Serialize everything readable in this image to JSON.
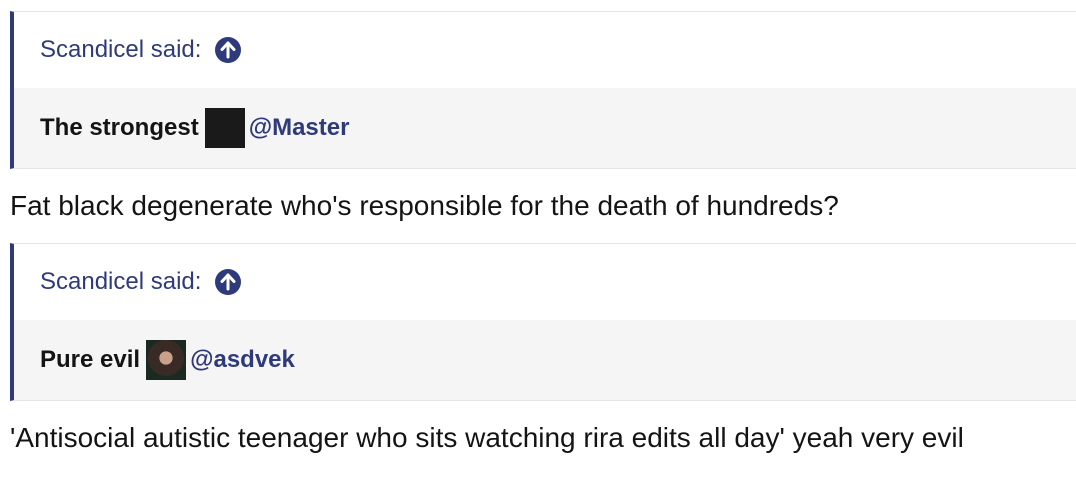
{
  "posts": [
    {
      "quote_author": "Scandicel said:",
      "quote_text": "The strongest",
      "mention": "@Master",
      "reply": "Fat black degenerate who's responsible for the death of hundreds?"
    },
    {
      "quote_author": "Scandicel said:",
      "quote_text": "Pure evil",
      "mention": "@asdvek",
      "reply": "'Antisocial autistic teenager who sits watching rira edits all day' yeah very evil"
    }
  ],
  "colors": {
    "accent": "#2e3a7a",
    "quote_bg": "#f5f5f5",
    "text": "#141414"
  },
  "icons": {
    "jump_to_quote": "arrow-up-circle-icon"
  }
}
